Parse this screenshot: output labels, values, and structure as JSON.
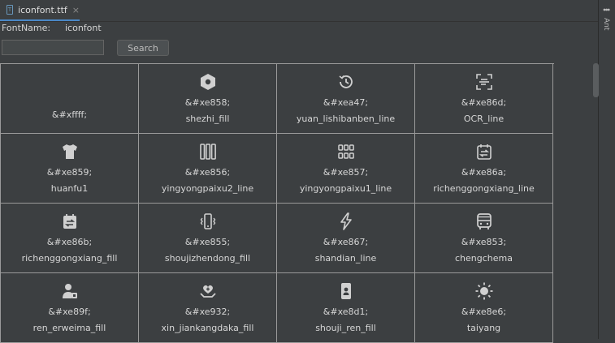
{
  "tab": {
    "label": "iconfont.ttf",
    "close": "×",
    "file_icon": "ttf-file-icon"
  },
  "right_panel": {
    "label": "Ant",
    "icon": "ant-icon"
  },
  "font": {
    "name_label": "FontName:",
    "name_value": "iconfont"
  },
  "search": {
    "placeholder": "",
    "value": "",
    "button_label": "Search"
  },
  "colors": {
    "background": "#3c3f41",
    "grid_line": "#9a9a9a",
    "text": "#d6d6d6",
    "accent": "#4a88c7",
    "icon": "#d0d0d0"
  },
  "glyphs": [
    {
      "code": "&#xffff;",
      "name": "",
      "icon": ""
    },
    {
      "code": "&#xe858;",
      "name": "shezhi_fill",
      "icon": "settings-hex-icon"
    },
    {
      "code": "&#xea47;",
      "name": "yuan_lishibanben_line",
      "icon": "history-clock-icon"
    },
    {
      "code": "&#xe86d;",
      "name": "OCR_line",
      "icon": "ocr-scan-icon"
    },
    {
      "code": "&#xe859;",
      "name": "huanfu1",
      "icon": "tshirt-icon"
    },
    {
      "code": "&#xe856;",
      "name": "yingyongpaixu2_line",
      "icon": "columns-icon"
    },
    {
      "code": "&#xe857;",
      "name": "yingyongpaixu1_line",
      "icon": "grid-icon"
    },
    {
      "code": "&#xe86a;",
      "name": "richenggongxiang_line",
      "icon": "calendar-share-icon"
    },
    {
      "code": "&#xe86b;",
      "name": "richenggongxiang_fill",
      "icon": "calendar-share-fill-icon"
    },
    {
      "code": "&#xe855;",
      "name": "shoujizhendong_fill",
      "icon": "phone-vibrate-icon"
    },
    {
      "code": "&#xe867;",
      "name": "shandian_line",
      "icon": "lightning-icon"
    },
    {
      "code": "&#xe853;",
      "name": "chengchema",
      "icon": "bus-icon"
    },
    {
      "code": "&#xe89f;",
      "name": "ren_erweima_fill",
      "icon": "person-qrcode-icon"
    },
    {
      "code": "&#xe932;",
      "name": "xin_jiankangdaka_fill",
      "icon": "heart-health-icon"
    },
    {
      "code": "&#xe8d1;",
      "name": "shouji_ren_fill",
      "icon": "phone-person-icon"
    },
    {
      "code": "&#xe8e6;",
      "name": "taiyang",
      "icon": "sun-icon"
    }
  ]
}
